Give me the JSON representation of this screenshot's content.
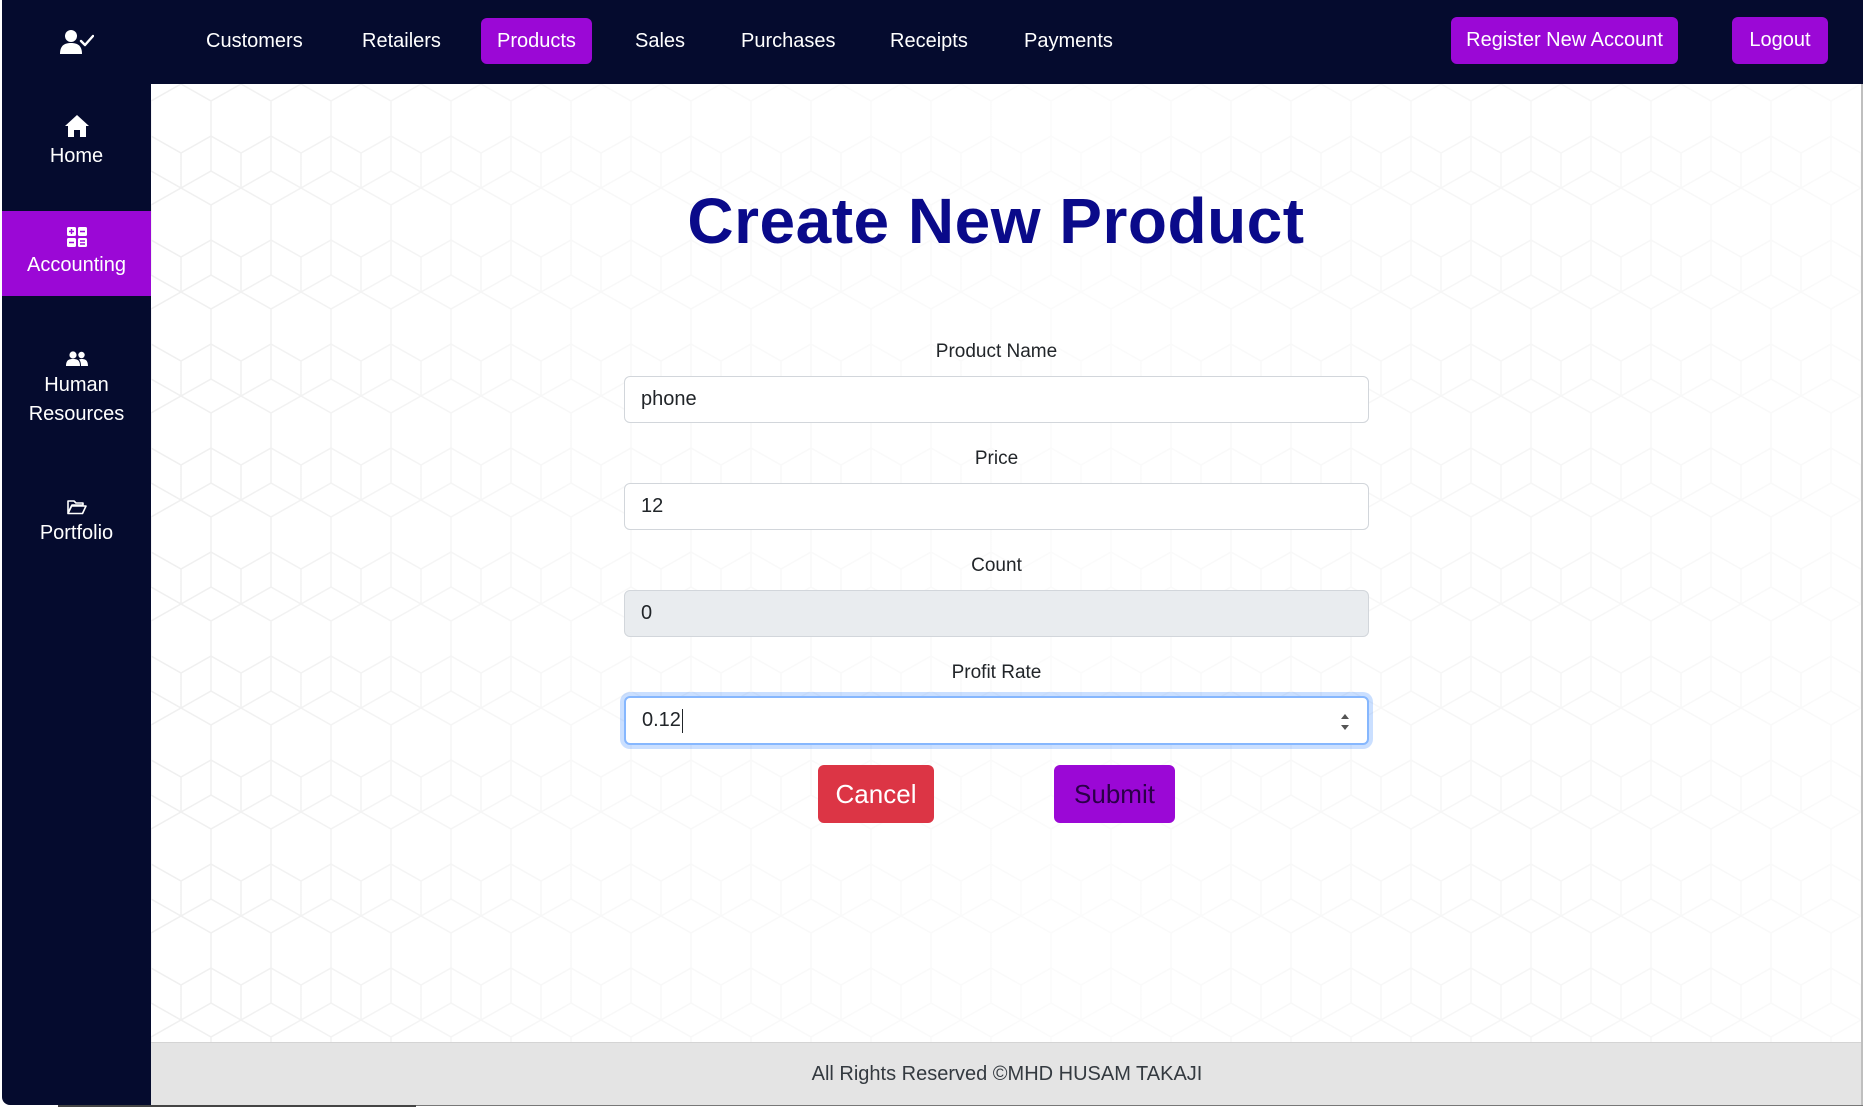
{
  "colors": {
    "navy": "#050b2e",
    "accent": "#9b08d6",
    "danger": "#dc3545",
    "title": "#0a0a8a"
  },
  "sidebar": {
    "user_icon": "user-check-icon",
    "items": [
      {
        "label": "Home",
        "icon": "home-icon",
        "active": false
      },
      {
        "label": "Accounting",
        "icon": "calculator-icon",
        "active": true
      },
      {
        "label": "Human Resources",
        "label_line1": "Human",
        "label_line2": "Resources",
        "icon": "users-icon",
        "active": false
      },
      {
        "label": "Portfolio",
        "icon": "folder-open-icon",
        "active": false
      }
    ]
  },
  "topnav": {
    "links": [
      "Customers",
      "Retailers",
      "Products",
      "Sales",
      "Purchases",
      "Receipts",
      "Payments"
    ],
    "active": "Products",
    "register_label": "Register New Account",
    "logout_label": "Logout"
  },
  "form": {
    "title": "Create New Product",
    "fields": [
      {
        "label": "Product Name",
        "value": "phone",
        "disabled": false
      },
      {
        "label": "Price",
        "value": "12",
        "disabled": false
      },
      {
        "label": "Count",
        "value": "0",
        "disabled": true
      },
      {
        "label": "Profit Rate",
        "value": "0.12",
        "disabled": false,
        "focused": true
      }
    ],
    "cancel_label": "Cancel",
    "submit_label": "Submit"
  },
  "footer": {
    "text": "All Rights Reserved ©MHD HUSAM TAKAJI"
  }
}
